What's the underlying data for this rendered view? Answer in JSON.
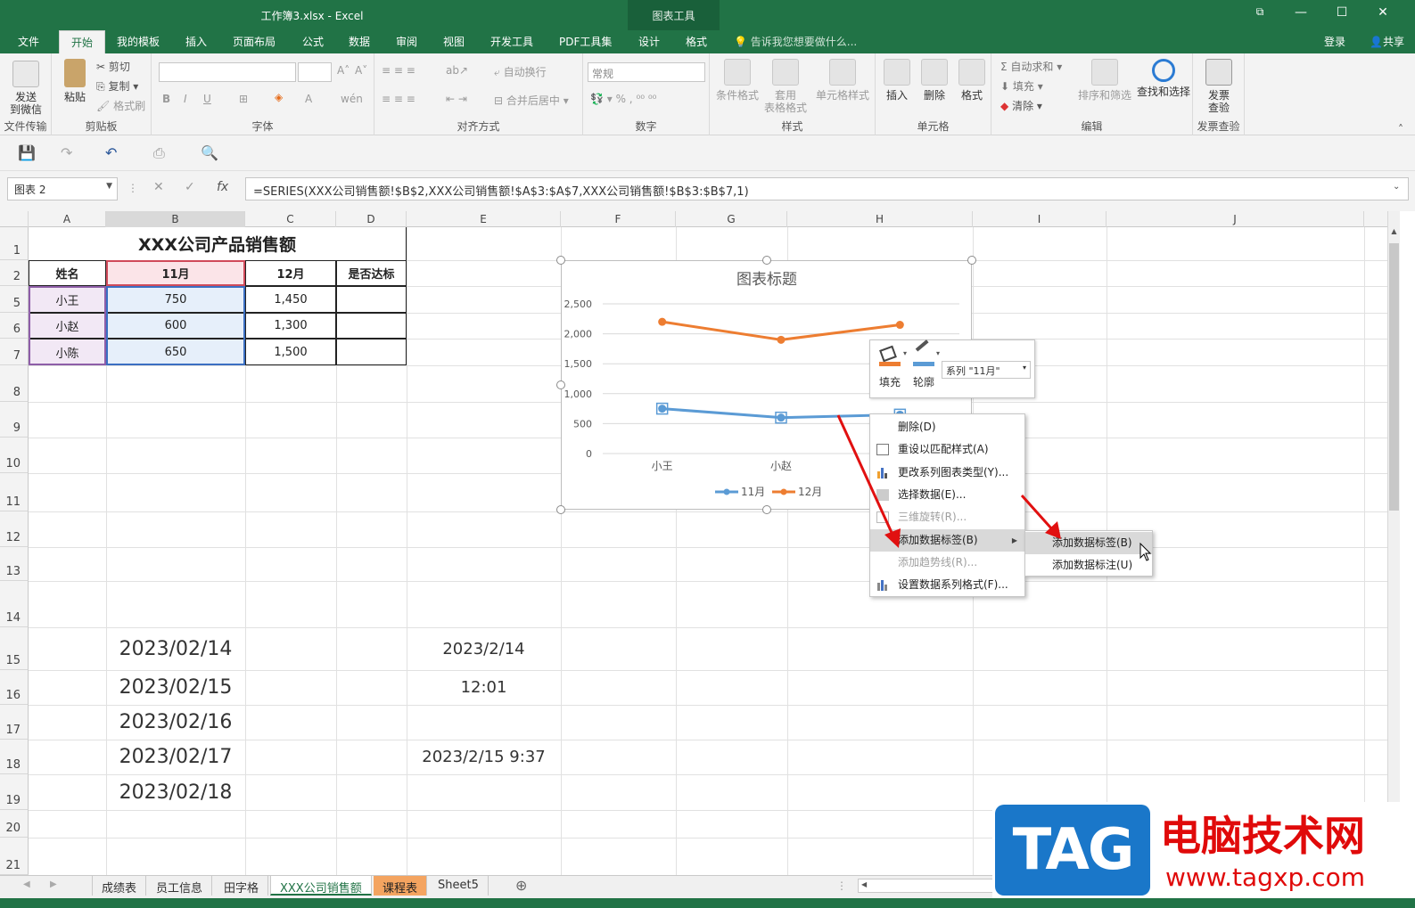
{
  "window": {
    "title": "工作簿3.xlsx - Excel",
    "context_tab_group": "图表工具",
    "restore_icon": "ribbon-display-icon",
    "minimize": "—",
    "maximize": "☐",
    "close": "✕"
  },
  "tabs": [
    "文件",
    "开始",
    "我的模板",
    "插入",
    "页面布局",
    "公式",
    "数据",
    "审阅",
    "视图",
    "开发工具",
    "PDF工具集",
    "设计",
    "格式"
  ],
  "active_tab": "开始",
  "tellme": "告诉我您想要做什么...",
  "login": "登录",
  "share": "共享",
  "ribbon": {
    "send_wechat": "发送到微信",
    "send_wechat_l1": "发送",
    "send_wechat_l2": "到微信",
    "group_file_transfer": "文件传输",
    "paste": "粘贴",
    "cut": "剪切",
    "copy": "复制",
    "format_painter": "格式刷",
    "group_clipboard": "剪贴板",
    "group_font": "字体",
    "bold": "B",
    "italic": "I",
    "underline": "U",
    "wrap_text": "自动换行",
    "merge_center": "合并后居中",
    "group_align": "对齐方式",
    "number_format": "常规",
    "group_number": "数字",
    "cond_format": "条件格式",
    "table_format_l1": "套用",
    "table_format_l2": "表格格式",
    "cell_style": "单元格样式",
    "group_style": "样式",
    "insert": "插入",
    "delete": "删除",
    "format": "格式",
    "group_cells": "单元格",
    "autosum": "自动求和",
    "fill": "填充",
    "clear": "清除",
    "sort_filter": "排序和筛选",
    "find_select": "查找和选择",
    "group_edit": "编辑",
    "invoice_check_l1": "发票",
    "invoice_check_l2": "查验",
    "group_invoice": "发票查验"
  },
  "formula_bar": {
    "name_box": "图表 2",
    "formula": "=SERIES(XXX公司销售额!$B$2,XXX公司销售额!$A$3:$A$7,XXX公司销售额!$B$3:$B$7,1)",
    "fx": "fx"
  },
  "columns": [
    "A",
    "B",
    "C",
    "D",
    "E",
    "F",
    "G",
    "H",
    "I",
    "J"
  ],
  "rows": [
    "1",
    "2",
    "5",
    "6",
    "7",
    "8",
    "9",
    "10",
    "11",
    "12",
    "13",
    "14",
    "15",
    "16",
    "17",
    "18",
    "19",
    "20",
    "21"
  ],
  "table": {
    "title": "XXX公司产品销售额",
    "headers": [
      "姓名",
      "11月",
      "12月",
      "是否达标"
    ],
    "rows": [
      [
        "小王",
        "750",
        "1,450",
        ""
      ],
      [
        "小赵",
        "600",
        "1,300",
        ""
      ],
      [
        "小陈",
        "650",
        "1,500",
        ""
      ]
    ]
  },
  "dates_b": [
    "2023/02/14",
    "2023/02/15",
    "2023/02/16",
    "2023/02/17",
    "2023/02/18"
  ],
  "dates_e": [
    "2023/2/14",
    "12:01",
    "",
    "2023/2/15 9:37",
    ""
  ],
  "chart_data": {
    "type": "line",
    "title": "图表标题",
    "categories": [
      "小王",
      "小赵",
      "小陈"
    ],
    "series": [
      {
        "name": "11月",
        "values": [
          750,
          600,
          650
        ],
        "color": "#5b9bd5"
      },
      {
        "name": "12月",
        "values": [
          2200,
          1900,
          2150
        ],
        "color": "#ed7d31"
      }
    ],
    "ylim": [
      0,
      2500
    ],
    "yticks": [
      "0",
      "500",
      "1,000",
      "1,500",
      "2,000",
      "2,500"
    ],
    "grid": true,
    "legend": "bottom"
  },
  "mini_toolbar": {
    "fill": "填充",
    "outline": "轮廓",
    "series_selected": "系列 \"11月\""
  },
  "context_menu": [
    {
      "label": "删除(D)",
      "enabled": true
    },
    {
      "label": "重设以匹配样式(A)",
      "enabled": true
    },
    {
      "label": "更改系列图表类型(Y)...",
      "enabled": true
    },
    {
      "label": "选择数据(E)...",
      "enabled": true
    },
    {
      "label": "三维旋转(R)...",
      "enabled": false
    },
    {
      "label": "添加数据标签(B)",
      "enabled": true
    },
    {
      "label": "添加趋势线(R)...",
      "enabled": false
    },
    {
      "label": "设置数据系列格式(F)...",
      "enabled": true
    }
  ],
  "submenu": [
    "添加数据标签(B)",
    "添加数据标注(U)"
  ],
  "sheet_tabs": [
    "成绩表",
    "员工信息",
    "田字格",
    "XXX公司销售额",
    "课程表",
    "Sheet5"
  ],
  "active_sheet": "XXX公司销售额",
  "watermark": {
    "tag": "TAG",
    "name": "电脑技术网",
    "url": "www.tagxp.com"
  },
  "colors": {
    "excel_green": "#217346",
    "orange_tab": "#f4a460",
    "arrow_red": "#e11010"
  }
}
